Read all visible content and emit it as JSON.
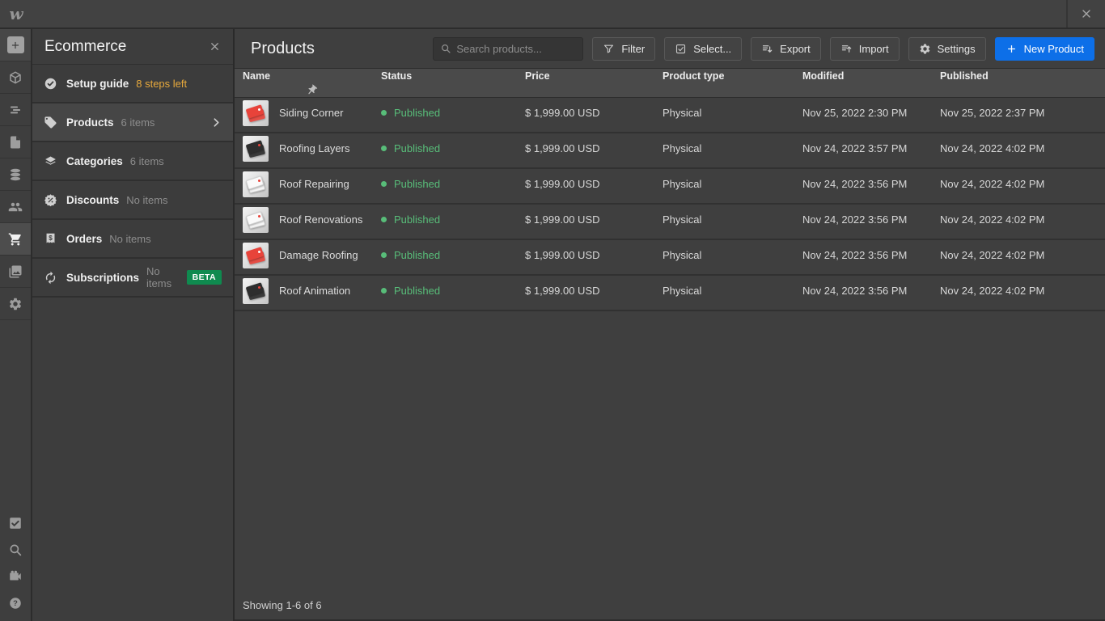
{
  "window": {
    "logo": "w"
  },
  "toolbar": {
    "top_icons": [
      "add",
      "components",
      "navigator",
      "pages",
      "cms",
      "users",
      "ecommerce",
      "assets",
      "settings"
    ],
    "active_icon": "ecommerce",
    "bottom_icons": [
      "audit",
      "search",
      "video-tutorials",
      "help"
    ]
  },
  "sidebar": {
    "title": "Ecommerce",
    "items": [
      {
        "label": "Setup guide",
        "meta": "8 steps left",
        "icon": "check-circle",
        "meta_style": "warning"
      },
      {
        "label": "Products",
        "meta": "6 items",
        "icon": "tag",
        "active": true,
        "chevron": true
      },
      {
        "label": "Categories",
        "meta": "6 items",
        "icon": "category"
      },
      {
        "label": "Discounts",
        "meta": "No items",
        "icon": "discount"
      },
      {
        "label": "Orders",
        "meta": "No items",
        "icon": "orders"
      },
      {
        "label": "Subscriptions",
        "meta": "No items",
        "icon": "subscriptions",
        "badge": "BETA"
      }
    ]
  },
  "header": {
    "title": "Products",
    "search_placeholder": "Search products...",
    "buttons": [
      {
        "label": "Filter",
        "icon": "filter"
      },
      {
        "label": "Select...",
        "icon": "select"
      },
      {
        "label": "Export",
        "icon": "export"
      },
      {
        "label": "Import",
        "icon": "import"
      },
      {
        "label": "Settings",
        "icon": "settings"
      }
    ],
    "new_product_label": "New Product"
  },
  "table": {
    "columns": [
      "Name",
      "Status",
      "Price",
      "Product type",
      "Modified",
      "Published"
    ],
    "rows": [
      {
        "name": "Siding Corner",
        "thumb": "red",
        "status": "Published",
        "price": "$ 1,999.00 USD",
        "type": "Physical",
        "modified": "Nov 25, 2022 2:30 PM",
        "published": "Nov 25, 2022 2:37 PM"
      },
      {
        "name": "Roofing Layers",
        "thumb": "black",
        "status": "Published",
        "price": "$ 1,999.00 USD",
        "type": "Physical",
        "modified": "Nov 24, 2022 3:57 PM",
        "published": "Nov 24, 2022 4:02 PM"
      },
      {
        "name": "Roof Repairing",
        "thumb": "white",
        "status": "Published",
        "price": "$ 1,999.00 USD",
        "type": "Physical",
        "modified": "Nov 24, 2022 3:56 PM",
        "published": "Nov 24, 2022 4:02 PM"
      },
      {
        "name": "Roof Renovations",
        "thumb": "white",
        "status": "Published",
        "price": "$ 1,999.00 USD",
        "type": "Physical",
        "modified": "Nov 24, 2022 3:56 PM",
        "published": "Nov 24, 2022 4:02 PM"
      },
      {
        "name": "Damage Roofing",
        "thumb": "red",
        "status": "Published",
        "price": "$ 1,999.00 USD",
        "type": "Physical",
        "modified": "Nov 24, 2022 3:56 PM",
        "published": "Nov 24, 2022 4:02 PM"
      },
      {
        "name": "Roof Animation",
        "thumb": "black",
        "status": "Published",
        "price": "$ 1,999.00 USD",
        "type": "Physical",
        "modified": "Nov 24, 2022 3:56 PM",
        "published": "Nov 24, 2022 4:02 PM"
      }
    ],
    "footer": "Showing 1-6 of 6"
  },
  "colors": {
    "accent_blue": "#0d6fe8",
    "published_green": "#58bd79",
    "warning_amber": "#e7a93c",
    "beta_badge_green": "#0f8a4f"
  }
}
